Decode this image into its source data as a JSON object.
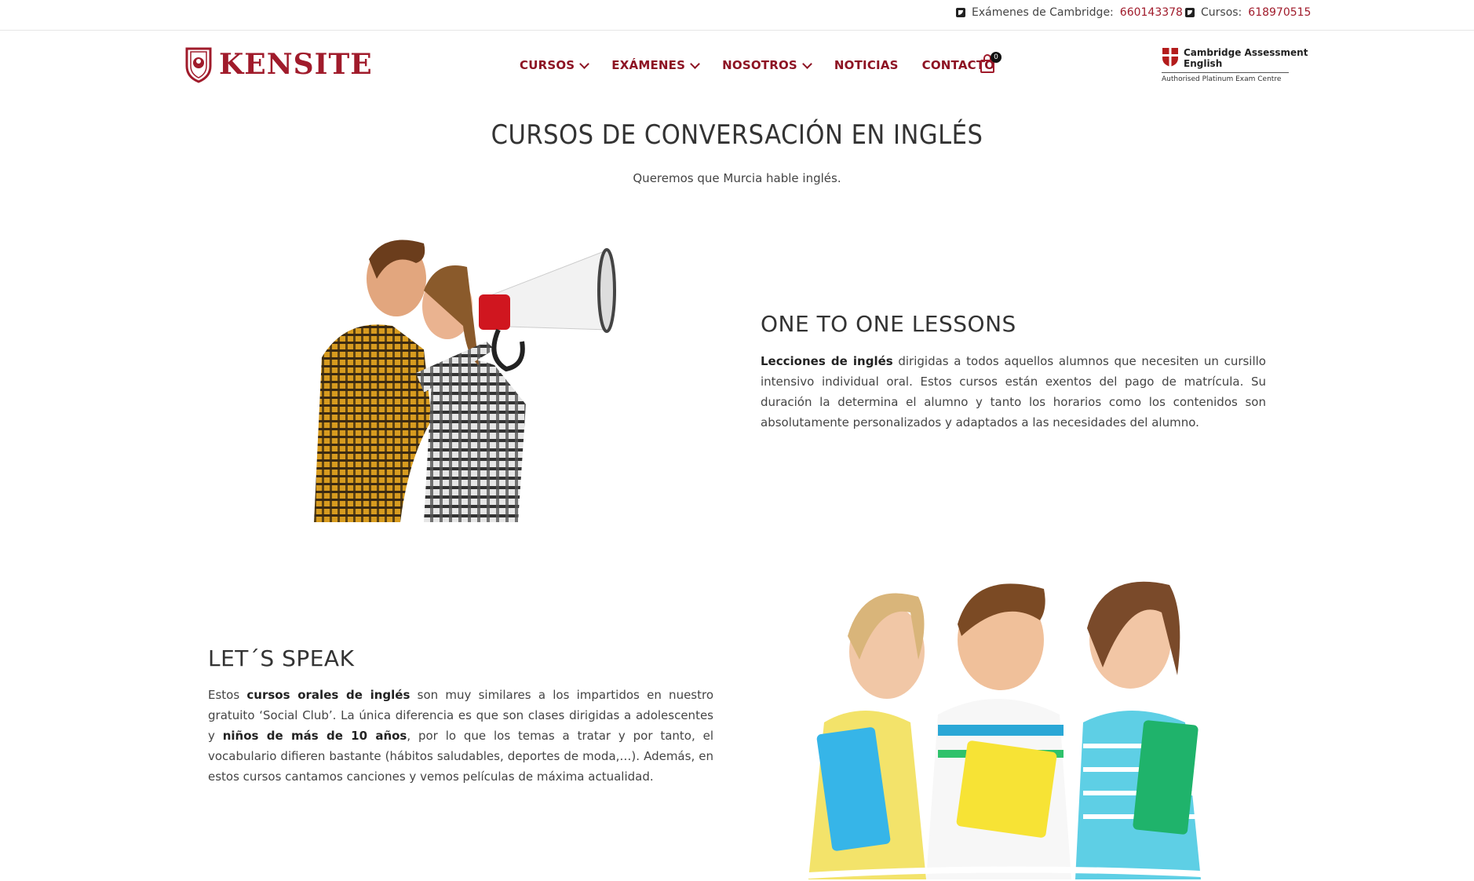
{
  "topbar": {
    "cambridge_label": "Exámenes de Cambridge:",
    "cambridge_phone": "660143378",
    "courses_label": "Cursos:",
    "courses_phone": "618970515"
  },
  "brand": {
    "logo_text": "KENSITE"
  },
  "nav": {
    "items": [
      {
        "label": "CURSOS",
        "has_dropdown": true
      },
      {
        "label": "EXÁMENES",
        "has_dropdown": true
      },
      {
        "label": "NOSOTROS",
        "has_dropdown": true
      },
      {
        "label": "NOTICIAS",
        "has_dropdown": false
      },
      {
        "label": "CONTACTO",
        "has_dropdown": false
      }
    ],
    "cart_count": "0"
  },
  "cambridge_badge": {
    "line1": "Cambridge Assessment",
    "line2": "English",
    "tagline": "Authorised Platinum Exam Centre"
  },
  "hero": {
    "title": "CURSOS DE CONVERSACIÓN EN INGLÉS",
    "subtitle": "Queremos que Murcia hable inglés."
  },
  "section1": {
    "title": "ONE TO ONE LESSONS",
    "bold_intro": "Lecciones de inglés",
    "text": " dirigidas a todos aquellos alumnos que necesiten un cursillo intensivo individual oral. Estos cursos están exentos del pago de matrícula. Su duración la determina el alumno y tanto los horarios como los contenidos son absolutamente personalizados y adaptados a las necesidades del alumno."
  },
  "section2": {
    "title": "LET´S SPEAK",
    "p1": "Estos ",
    "b1": "cursos orales de inglés",
    "p2": " son muy similares a los impartidos en nuestro gratuito ‘Social Club’. La única diferencia es que son clases dirigidas a adolescentes y ",
    "b2": "niños de más de 10 años",
    "p3": ", por lo que los temas a tratar y por tanto, el vocabulario difieren bastante (hábitos saludables, deportes de moda,…). Además, en estos cursos cantamos canciones y vemos películas de máxima actualidad."
  },
  "colors": {
    "brand": "#a01b2b",
    "nav": "#8d1323",
    "text": "#444444"
  }
}
